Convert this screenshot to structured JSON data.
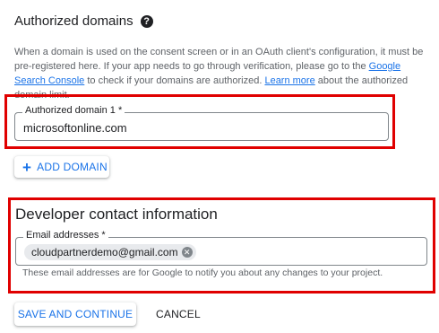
{
  "authorized_domains": {
    "title": "Authorized domains",
    "help_icon": "question-circle-icon",
    "description_1": "When a domain is used on the consent screen or in an OAuth client's configuration, it must be pre-registered here. If your app needs to go through verification, please go to the ",
    "link_search_console": "Google Search Console",
    "description_2": " to check if your domains are authorized. ",
    "link_learn_more": "Learn more",
    "description_3": " about the authorized domain limit.",
    "field_label": "Authorized domain 1 *",
    "field_value": "microsoftonline.com",
    "add_button_icon": "plus-icon",
    "add_button_label": "ADD DOMAIN"
  },
  "developer_contact": {
    "title": "Developer contact information",
    "field_label": "Email addresses *",
    "chip_value": "cloudpartnerdemo@gmail.com",
    "chip_remove_icon": "close-circle-icon",
    "hint": "These email addresses are for Google to notify you about any changes to your project."
  },
  "actions": {
    "save_label": "SAVE AND CONTINUE",
    "cancel_label": "CANCEL"
  },
  "colors": {
    "accent": "#1a73e8",
    "highlight_border": "#e00000",
    "text": "#202124",
    "muted": "#5f6368"
  }
}
